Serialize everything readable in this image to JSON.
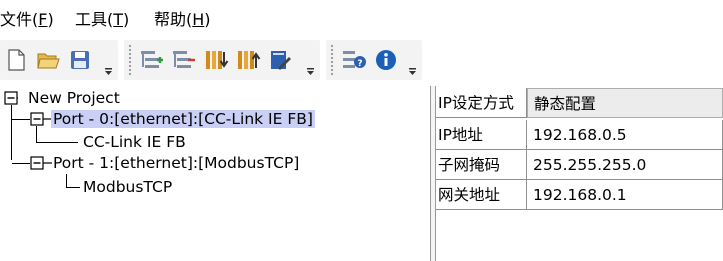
{
  "menu": {
    "items": [
      {
        "label": "文件(",
        "accel": "F",
        "suffix": ")"
      },
      {
        "label": "工具(",
        "accel": "T",
        "suffix": ")"
      },
      {
        "label": "帮助(",
        "accel": "H",
        "suffix": ")"
      }
    ]
  },
  "toolbar": {
    "groups": [
      {
        "buttons": [
          "new-file-icon",
          "open-folder-icon",
          "save-disk-icon"
        ]
      },
      {
        "buttons": [
          "add-node-icon",
          "remove-node-icon",
          "import-icon",
          "export-icon",
          "edit-pencil-icon"
        ]
      },
      {
        "buttons": [
          "help-context-icon",
          "info-icon"
        ]
      }
    ]
  },
  "tree": {
    "root": "New Project",
    "ports": [
      {
        "label": "Port - 0:[ethernet]:[CC-Link IE FB]",
        "child": "CC-Link IE FB",
        "selected": true
      },
      {
        "label": "Port - 1:[ethernet]:[ModbusTCP]",
        "child": "ModbusTCP",
        "selected": false
      }
    ]
  },
  "properties": [
    {
      "name": "IP设定方式",
      "value": "静态配置",
      "type": "combo"
    },
    {
      "name": "IP地址",
      "value": "192.168.0.5",
      "type": "text"
    },
    {
      "name": "子网掩码",
      "value": "255.255.255.0",
      "type": "text"
    },
    {
      "name": "网关地址",
      "value": "192.168.0.1",
      "type": "text"
    }
  ],
  "colors": {
    "selection": "#c9cff5",
    "toolbar_bg": "#f3f3f3",
    "grid_line": "#8f8f8f",
    "accent_blue": "#1c5fb8"
  }
}
